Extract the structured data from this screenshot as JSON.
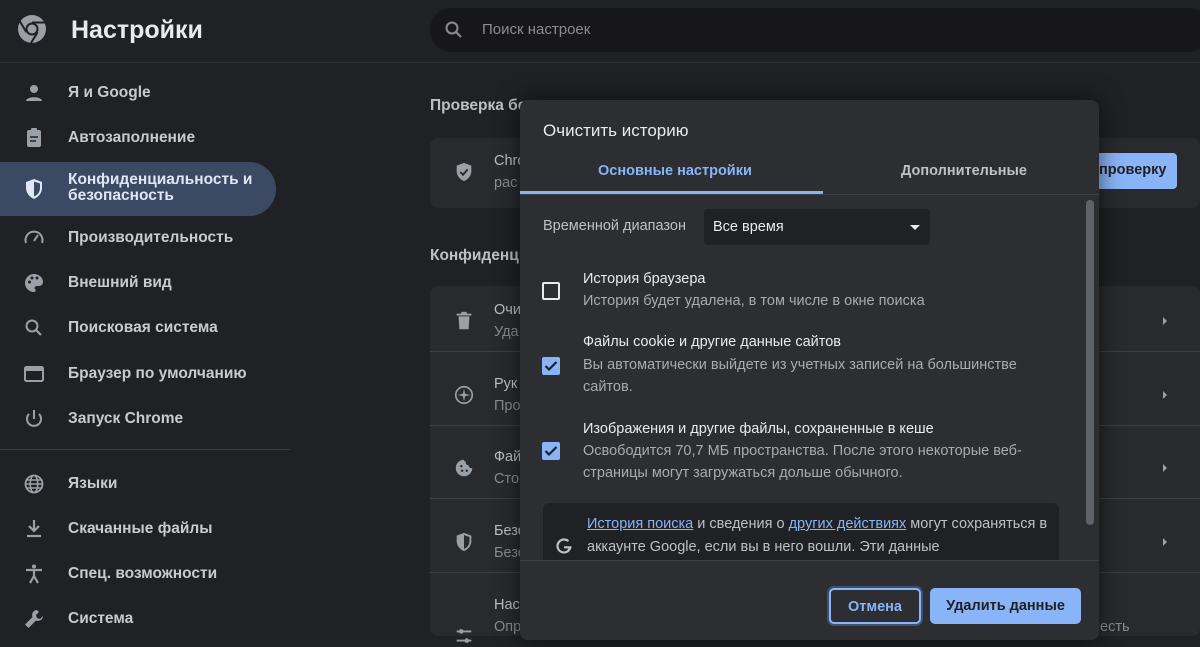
{
  "header": {
    "title": "Настройки",
    "search_placeholder": "Поиск настроек"
  },
  "sidebar": {
    "items": [
      {
        "label": "Я и Google",
        "icon": "person-icon"
      },
      {
        "label": "Автозаполнение",
        "icon": "clipboard-icon"
      },
      {
        "label": "Конфиденциальность и безопасность",
        "icon": "shield-icon",
        "active": true
      },
      {
        "label": "Производительность",
        "icon": "speedometer-icon"
      },
      {
        "label": "Внешний вид",
        "icon": "palette-icon"
      },
      {
        "label": "Поисковая система",
        "icon": "search-icon"
      },
      {
        "label": "Браузер по умолчанию",
        "icon": "browser-icon"
      },
      {
        "label": "Запуск Chrome",
        "icon": "power-icon"
      },
      {
        "label": "Языки",
        "icon": "globe-icon"
      },
      {
        "label": "Скачанные файлы",
        "icon": "download-icon"
      },
      {
        "label": "Спец. возможности",
        "icon": "accessibility-icon"
      },
      {
        "label": "Система",
        "icon": "wrench-icon"
      }
    ]
  },
  "content": {
    "safety_heading": "Проверка бе",
    "safety_row": {
      "title": "Chro",
      "subtitle": "рас",
      "button": "проверку"
    },
    "privacy_heading": "Конфиденц",
    "rows": [
      {
        "title": "Очи",
        "subtitle": "Уда",
        "icon": "trash-icon"
      },
      {
        "title": "Рук",
        "subtitle": "Про",
        "icon": "compass-icon"
      },
      {
        "title": "Фай",
        "subtitle": "Сто",
        "icon": "cookie-icon"
      },
      {
        "title": "Безо",
        "subtitle": "Безо",
        "icon": "shield-icon"
      },
      {
        "title": "Нас",
        "subtitle": "Опр",
        "icon": "sliders-icon",
        "trailing": "есть"
      }
    ]
  },
  "dialog": {
    "title": "Очистить историю",
    "tabs": [
      "Основные настройки",
      "Дополнительные"
    ],
    "time_range_label": "Временной диапазон",
    "time_range_value": "Все время",
    "options": [
      {
        "title": "История браузера",
        "description": "История будет удалена, в том числе в окне поиска",
        "checked": false
      },
      {
        "title": "Файлы cookie и другие данные сайтов",
        "description": "Вы автоматически выйдете из учетных записей на большинстве сайтов.",
        "checked": true
      },
      {
        "title": "Изображения и другие файлы, сохраненные в кеше",
        "description": "Освободится 70,7 МБ пространства. После этого некоторые веб-страницы могут загружаться дольше обычного.",
        "checked": true
      }
    ],
    "info": {
      "link1": "История поиска",
      "text1": " и сведения о ",
      "link2": "других действиях",
      "text2": " могут сохраняться в аккаунте Google, если вы в него вошли. Эти данные"
    },
    "cancel_label": "Отмена",
    "delete_label": "Удалить данные"
  },
  "colors": {
    "background": "#202124",
    "accent": "#8ab4f8",
    "active_nav": "#3b4a62",
    "dialog": "#2d2e31"
  }
}
